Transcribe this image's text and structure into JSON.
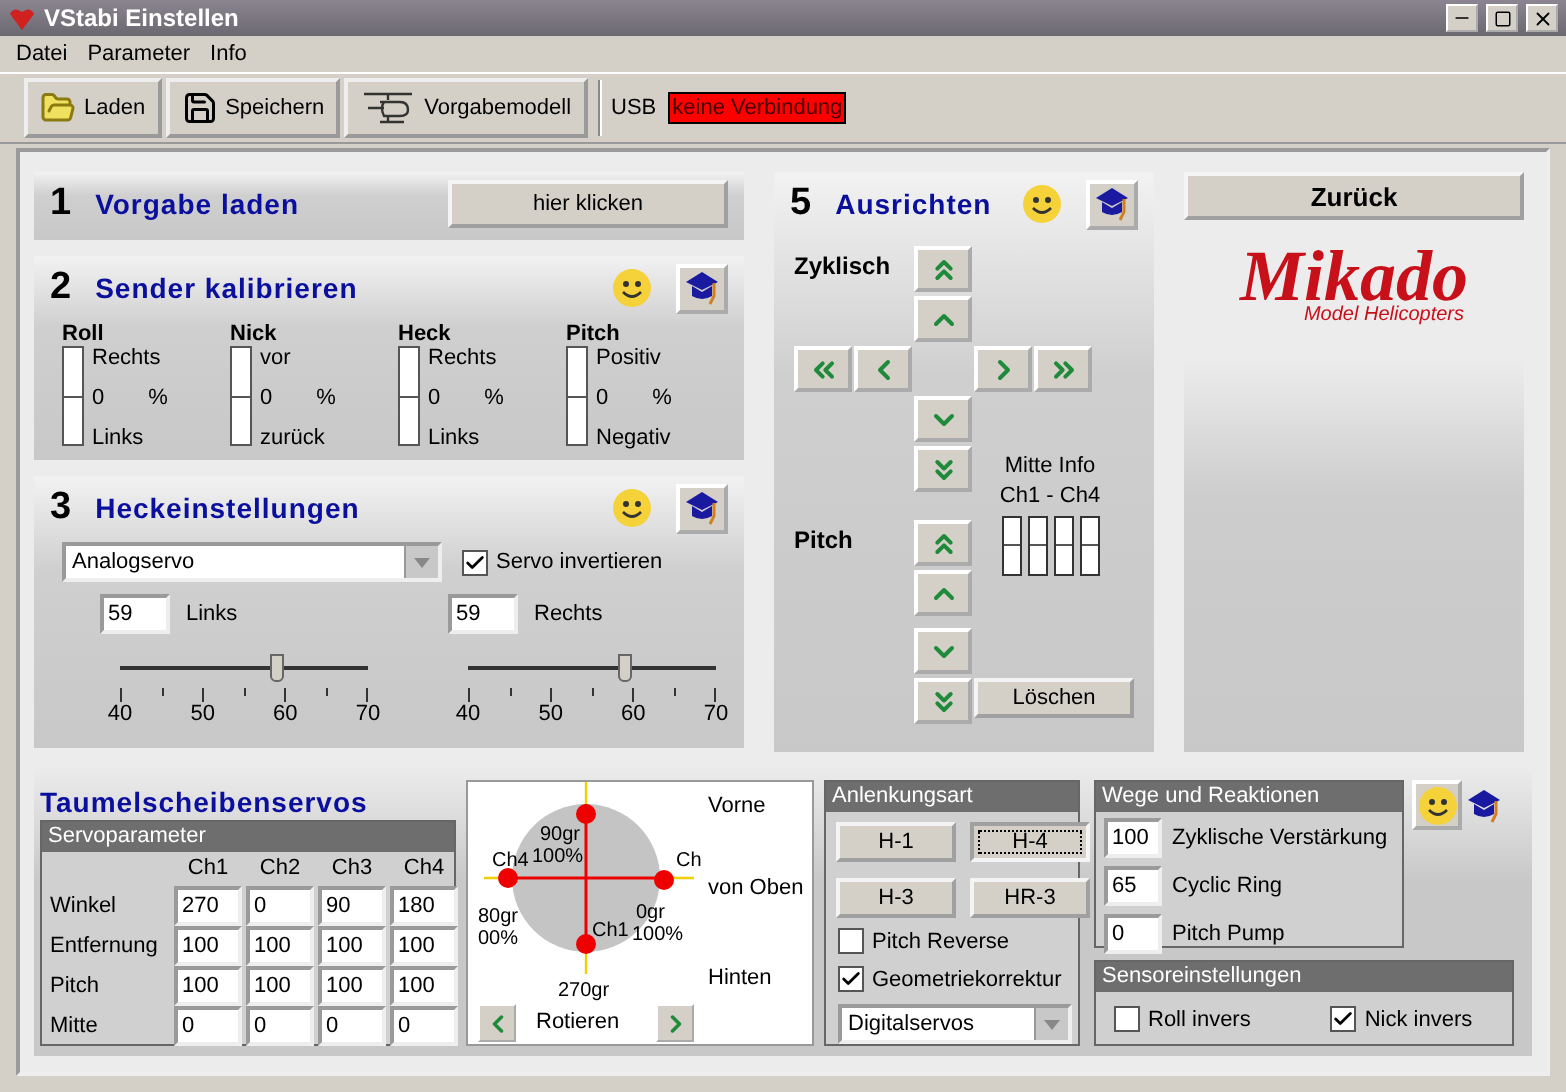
{
  "window": {
    "title": "VStabi Einstellen"
  },
  "menu": [
    "Datei",
    "Parameter",
    "Info"
  ],
  "toolbar": {
    "buttons": [
      "Laden",
      "Speichern",
      "Vorgabemodell"
    ],
    "usb_label": "USB",
    "usb_status": "keine Verbindung"
  },
  "step1": {
    "number": "1",
    "title": "Vorgabe laden",
    "button": "hier klicken"
  },
  "step2": {
    "number": "2",
    "title": "Sender kalibrieren",
    "channels": [
      {
        "name": "Roll",
        "top": "Rechts",
        "value": "0",
        "unit": "%",
        "bottom": "Links"
      },
      {
        "name": "Nick",
        "top": "vor",
        "value": "0",
        "unit": "%",
        "bottom": "zurück"
      },
      {
        "name": "Heck",
        "top": "Rechts",
        "value": "0",
        "unit": "%",
        "bottom": "Links"
      },
      {
        "name": "Pitch",
        "top": "Positiv",
        "value": "0",
        "unit": "%",
        "bottom": "Negativ"
      }
    ]
  },
  "step3": {
    "number": "3",
    "title": "Heckeinstellungen",
    "servo_type": "Analogservo",
    "invert": {
      "label": "Servo invertieren",
      "checked": true
    },
    "sliders": [
      {
        "value": "59",
        "label": "Links",
        "level": 0.633,
        "ticks": [
          "40",
          "50",
          "60",
          "70"
        ]
      },
      {
        "value": "59",
        "label": "Rechts",
        "level": 0.633,
        "ticks": [
          "40",
          "50",
          "60",
          "70"
        ]
      }
    ]
  },
  "step5": {
    "number": "5",
    "title": "Ausrichten",
    "cyclic_label": "Zyklisch",
    "pitch_label": "Pitch",
    "center_info": [
      "Mitte Info",
      "Ch1 - Ch4"
    ],
    "clear_button": "Löschen"
  },
  "back_button": "Zurück",
  "logo": {
    "name": "Mikado",
    "tagline": "Model Helicopters"
  },
  "swashplate": {
    "title": "Taumelscheibenservos",
    "params_title": "Servoparameter",
    "columns": [
      "Ch1",
      "Ch2",
      "Ch3",
      "Ch4"
    ],
    "rows": [
      {
        "label": "Winkel",
        "values": [
          "270",
          "0",
          "90",
          "180"
        ]
      },
      {
        "label": "Entfernung",
        "values": [
          "100",
          "100",
          "100",
          "100"
        ]
      },
      {
        "label": "Pitch",
        "values": [
          "100",
          "100",
          "100",
          "100"
        ]
      },
      {
        "label": "Mitte",
        "values": [
          "0",
          "0",
          "0",
          "0"
        ]
      }
    ]
  },
  "diagram": {
    "labels": [
      "90gr",
      "Ch4",
      "100%",
      "Ch",
      "80gr",
      "00%",
      "0gr",
      "Ch1",
      "100%",
      "270gr"
    ],
    "sides": [
      "Vorne",
      "von Oben",
      "Hinten"
    ],
    "rotate": "Rotieren"
  },
  "linkage": {
    "title": "Anlenkungsart",
    "options": [
      {
        "label": "H-1",
        "selected": false
      },
      {
        "label": "H-4",
        "selected": true
      },
      {
        "label": "H-3",
        "selected": false
      },
      {
        "label": "HR-3",
        "selected": false
      }
    ],
    "checkboxes": [
      {
        "label": "Pitch Reverse",
        "checked": false
      },
      {
        "label": "Geometriekorrektur",
        "checked": true
      }
    ],
    "servo_type": "Digitalservos"
  },
  "travel": {
    "title": "Wege und Reaktionen",
    "fields": [
      {
        "value": "100",
        "label": "Zyklische Verstärkung"
      },
      {
        "value": "65",
        "label": "Cyclic Ring"
      },
      {
        "value": "0",
        "label": "Pitch Pump"
      }
    ]
  },
  "sensor": {
    "title": "Sensoreinstellungen",
    "checkboxes": [
      {
        "label": "Roll invers",
        "checked": false
      },
      {
        "label": "Nick invers",
        "checked": true
      }
    ]
  }
}
